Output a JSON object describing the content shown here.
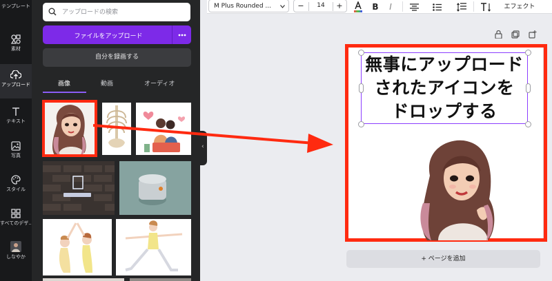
{
  "rail": {
    "items": [
      {
        "label": "テンプレート",
        "icon": "template-icon"
      },
      {
        "label": "素材",
        "icon": "elements-icon"
      },
      {
        "label": "アップロード",
        "icon": "upload-cloud-icon"
      },
      {
        "label": "テキスト",
        "icon": "text-icon"
      },
      {
        "label": "写真",
        "icon": "photo-icon"
      },
      {
        "label": "スタイル",
        "icon": "palette-icon"
      },
      {
        "label": "すべてのデザ...",
        "icon": "folder-icon"
      },
      {
        "label": "しなやか",
        "icon": "profile-icon"
      }
    ]
  },
  "panel": {
    "search_placeholder": "アップロードの検索",
    "upload_button": "ファイルをアップロード",
    "more_button": "•••",
    "record_button": "自分を録画する",
    "tabs": [
      "画像",
      "動画",
      "オーディオ"
    ],
    "active_tab": "画像"
  },
  "toolbar": {
    "font_name": "M Plus Rounded ...",
    "font_size": "14",
    "minus": "−",
    "plus": "+",
    "bold": "B",
    "italic": "I",
    "effect": "エフェクト"
  },
  "canvas": {
    "text_lines": [
      "無事にアップロード",
      "されたアイコンを",
      "ドロップする"
    ],
    "add_page": "+ ページを追加"
  },
  "colors": {
    "accent": "#7d2ae8",
    "annotation_red": "#ff2a10",
    "selection": "#8b3dff"
  }
}
